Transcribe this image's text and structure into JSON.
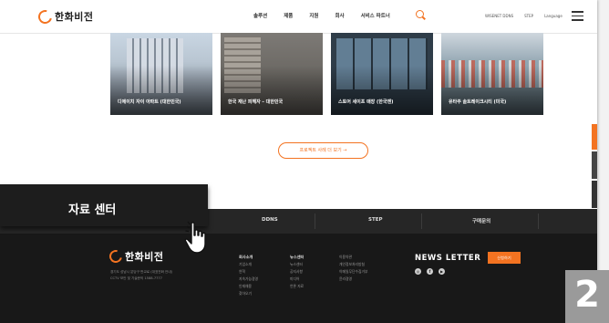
{
  "header": {
    "logo_text": "한화비전",
    "nav": [
      "솔루션",
      "제품",
      "지원",
      "회사",
      "서비스 파트너"
    ],
    "util": [
      "WISENET DDNS",
      "STEP",
      "Language"
    ],
    "colors": {
      "accent": "#f37321"
    }
  },
  "cards": [
    {
      "caption": "디에이치 자이 아파트 (대한민국)"
    },
    {
      "caption": "한국 재난 피해자 – 대한민국"
    },
    {
      "caption": "스토어 세이프 매장 (한국맨)"
    },
    {
      "caption": "유타주 솔트레이크시티 (미국)"
    }
  ],
  "more_button": "프로젝트 사례 더 보기 →",
  "footer_nav": [
    "DDNS",
    "STEP",
    "구매문의"
  ],
  "footer": {
    "logo_text": "한화비전",
    "address_lines": [
      "경기도 성남시 분당구 판교로 (대표전화 안내)",
      "CCTV 보안 및 기술문의 1588-7777"
    ],
    "columns": [
      {
        "heading": "회사소개",
        "items": [
          "기업소개",
          "연혁",
          "지속가능경영",
          "인재채용",
          "찾아오기"
        ]
      },
      {
        "heading": "뉴스센터",
        "items": [
          "뉴스센터",
          "공지사항",
          "미디어",
          "언론 자료"
        ]
      },
      {
        "heading": "",
        "items": [
          "이용약관",
          "개인정보처리방침",
          "이메일무단수집거부",
          "윤리경영"
        ]
      }
    ],
    "newsletter_title": "NEWS LETTER",
    "newsletter_button": "신청하기",
    "sns": [
      "instagram-icon",
      "facebook-icon",
      "youtube-icon"
    ]
  },
  "overlay": {
    "label": "자료 센터"
  },
  "step_number": "2"
}
